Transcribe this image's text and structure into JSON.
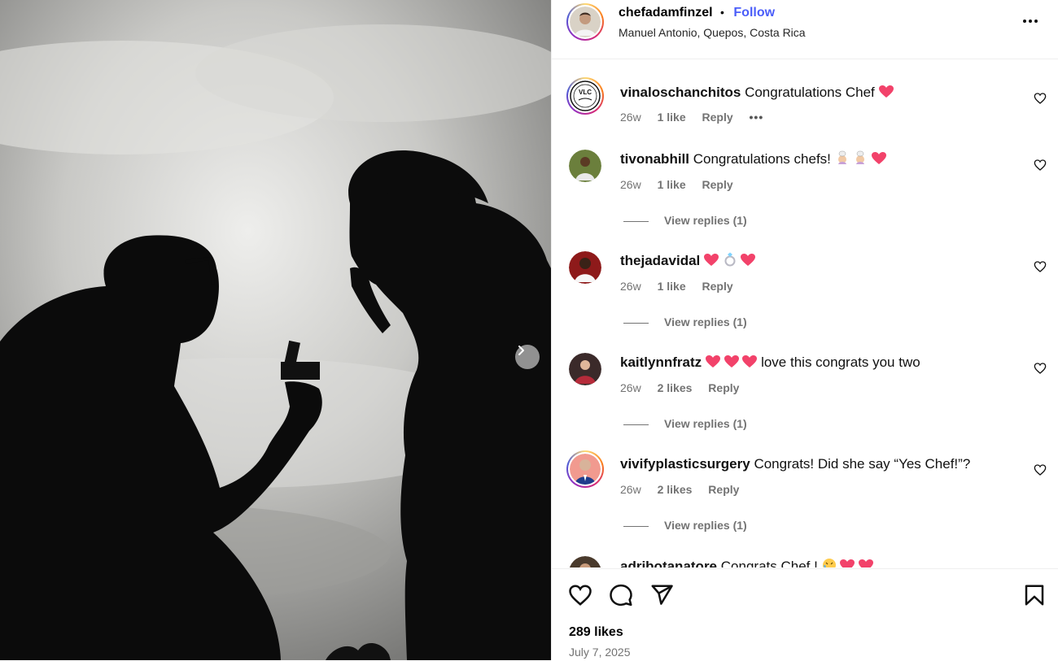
{
  "post": {
    "author": "chefadamfinzel",
    "follow_label": "Follow",
    "separator": "•",
    "location": "Manuel Antonio, Quepos, Costa Rica",
    "more_icon": "more-horizontal-icon"
  },
  "comments": [
    {
      "user": "vinaloschanchitos",
      "text": "Congratulations Chef",
      "emoji": [
        "red-heart"
      ],
      "age": "26w",
      "likes": "1 like",
      "reply": "Reply",
      "options": "•••",
      "avatar_ring": true,
      "avatar_text": "VLC"
    },
    {
      "user": "tivonabhill",
      "text": "Congratulations chefs!",
      "emoji": [
        "chef",
        "chef",
        "red-heart"
      ],
      "age": "26w",
      "likes": "1 like",
      "reply": "Reply",
      "view_replies": "View replies (1)"
    },
    {
      "user": "thejadavidal",
      "text": "",
      "emoji": [
        "red-heart",
        "ring",
        "red-heart"
      ],
      "age": "26w",
      "likes": "1 like",
      "reply": "Reply",
      "view_replies": "View replies (1)"
    },
    {
      "user": "kaitlynnfratz",
      "text": "love this congrats you two",
      "emoji": [
        "red-heart",
        "red-heart",
        "red-heart"
      ],
      "age": "26w",
      "likes": "2 likes",
      "reply": "Reply",
      "view_replies": "View replies (1)"
    },
    {
      "user": "vivifyplasticsurgery",
      "text": "Congrats! Did she say “Yes Chef!”?",
      "emoji": [],
      "age": "26w",
      "likes": "2 likes",
      "reply": "Reply",
      "view_replies": "View replies (1)",
      "avatar_ring": true
    },
    {
      "user": "adribotanatore",
      "text": "Congrats Chef !",
      "emoji": [
        "crying-face",
        "red-heart",
        "red-heart"
      ]
    }
  ],
  "footer": {
    "likes": "289 likes",
    "date": "July 7, 2025"
  },
  "colors": {
    "follow": "#4a5df9",
    "heart": "#f2426a",
    "muted": "#737373"
  },
  "icons": [
    "like-icon",
    "comment-icon",
    "share-icon",
    "save-icon",
    "next-photo-icon",
    "heart-icon"
  ]
}
